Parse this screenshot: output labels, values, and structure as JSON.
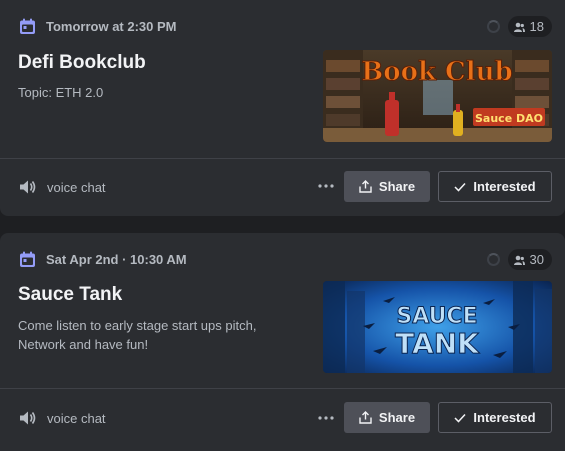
{
  "events": [
    {
      "date": "Tomorrow at 2:30 PM",
      "interested_count": "18",
      "title": "Defi Bookclub",
      "description": "Topic: ETH 2.0",
      "image_text": "Book Club",
      "image_subtext": "Sauce DAO",
      "location": "voice chat",
      "share_label": "Share",
      "interested_label": "Interested"
    },
    {
      "date": "Sat Apr 2nd · 10:30 AM",
      "interested_count": "30",
      "title": "Sauce Tank",
      "description": "Come listen to early stage start ups pitch, Network and have fun!",
      "image_text_line1": "SAUCE",
      "image_text_line2": "TANK",
      "location": "voice chat",
      "share_label": "Share",
      "interested_label": "Interested"
    }
  ],
  "icons": {
    "calendar": "calendar-icon",
    "people": "people-icon",
    "speaker": "speaker-icon",
    "share": "share-icon",
    "check": "check-icon",
    "more": "more-icon"
  },
  "colors": {
    "accent": "#949cf7",
    "card": "#2b2d31",
    "background": "#1e1f22"
  }
}
